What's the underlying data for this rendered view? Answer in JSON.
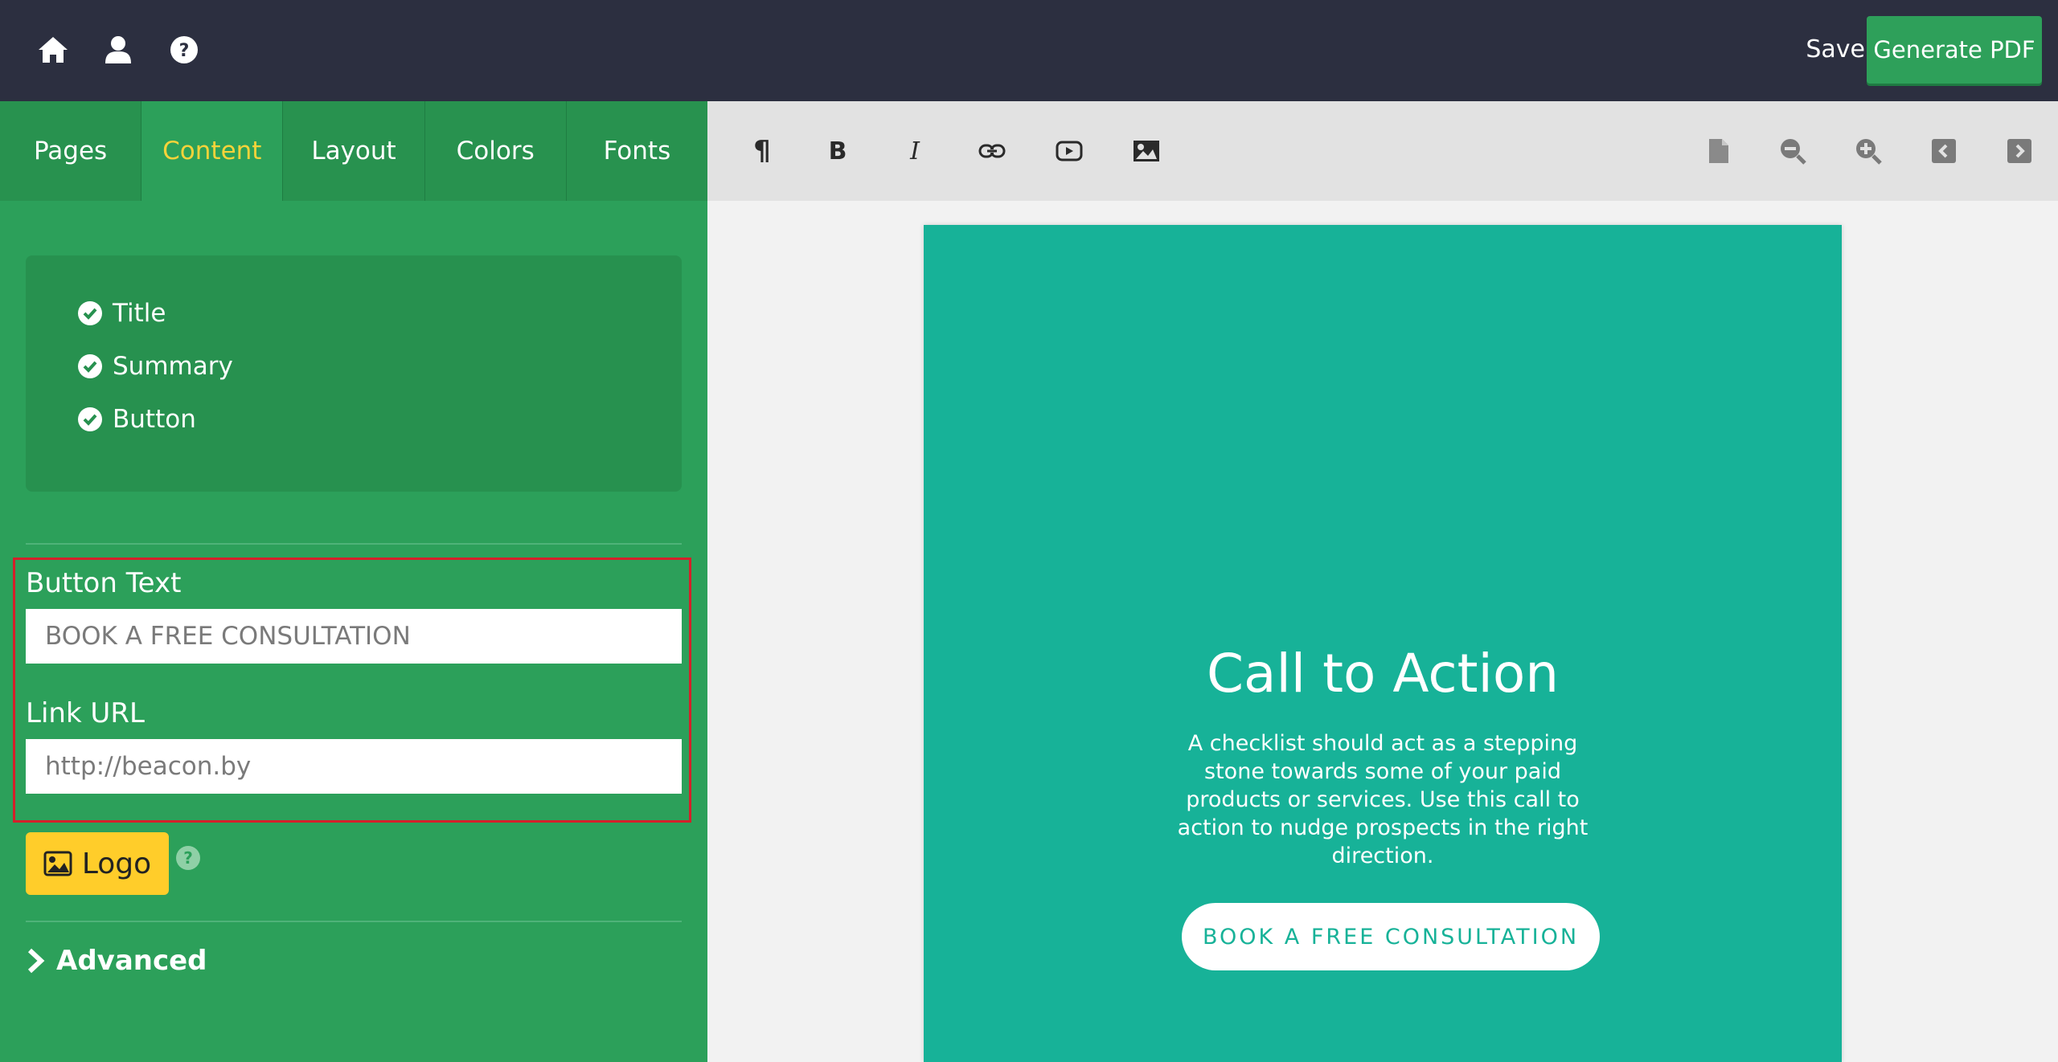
{
  "topbar": {
    "save_label": "Save",
    "generate_label": "Generate PDF",
    "icons": [
      "home-icon",
      "user-icon",
      "help-icon"
    ]
  },
  "sidebar": {
    "tabs": [
      {
        "label": "Pages",
        "active": false
      },
      {
        "label": "Content",
        "active": true
      },
      {
        "label": "Layout",
        "active": false
      },
      {
        "label": "Colors",
        "active": false
      },
      {
        "label": "Fonts",
        "active": false
      }
    ],
    "checklist": [
      {
        "label": "Title",
        "checked": true
      },
      {
        "label": "Summary",
        "checked": true
      },
      {
        "label": "Button",
        "checked": true
      }
    ],
    "button_text_label": "Button Text",
    "button_text_value": "BOOK A FREE CONSULTATION",
    "link_url_label": "Link URL",
    "link_url_value": "http://beacon.by",
    "logo_label": "Logo",
    "advanced_label": "Advanced"
  },
  "toolbar": {
    "icons": [
      "paragraph-icon",
      "bold-icon",
      "italic-icon",
      "link-icon",
      "video-icon",
      "image-icon",
      "page-icon",
      "zoom-out-icon",
      "zoom-in-icon",
      "prev-icon",
      "next-icon"
    ]
  },
  "page": {
    "title": "Call to Action",
    "text": "A checklist should act as a stepping stone towards some of your paid products or services. Use this call to action to nudge prospects in the right direction.",
    "button_label": "BOOK A FREE CONSULTATION"
  },
  "colors": {
    "topbar": "#2c2f40",
    "sidebar": "#2ca05a",
    "active_tab_text": "#f7d33a",
    "generate_button": "#2ea05a",
    "logo_button": "#ffcd2a",
    "page_bg": "#17b298",
    "highlight_border": "#d4202a"
  }
}
